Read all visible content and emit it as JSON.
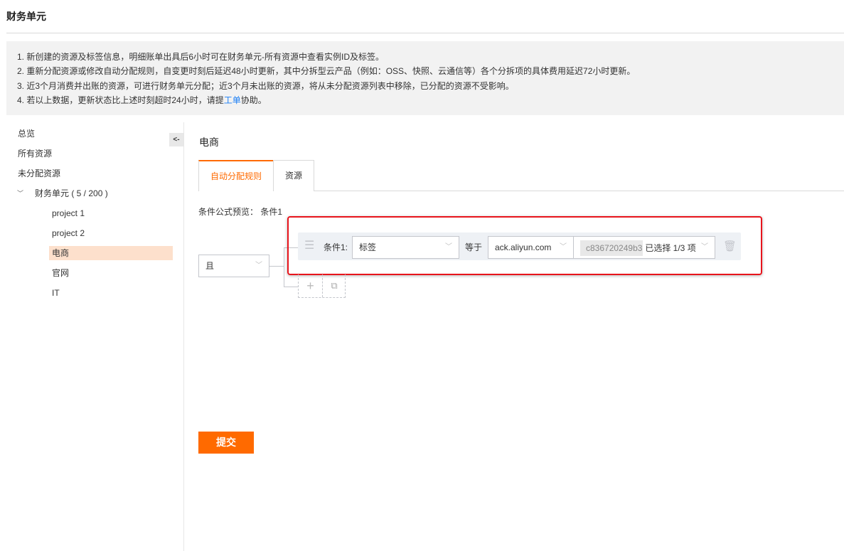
{
  "page_title": "财务单元",
  "notice": {
    "line1": "1. 新创建的资源及标签信息，明细账单出具后6小时可在财务单元-所有资源中查看实例ID及标签。",
    "line2": "2. 重新分配资源或修改自动分配规则，自变更时刻后延迟48小时更新，其中分拆型云产品（例如：OSS、快照、云通信等）各个分拆项的具体费用延迟72小时更新。",
    "line3": "3. 近3个月消费并出账的资源，可进行财务单元分配；近3个月未出账的资源，将从未分配资源列表中移除，已分配的资源不受影响。",
    "line4_prefix": "4. 若以上数据，更新状态比上述时刻超时24小时，请提",
    "line4_link": "工单",
    "line4_suffix": "协助。"
  },
  "sidebar": {
    "collapse_label": "<-",
    "items": [
      "总览",
      "所有资源",
      "未分配资源"
    ],
    "group_label": "财务单元 ( 5 / 200 )",
    "children": [
      "project 1",
      "project 2",
      "电商",
      "官网",
      "IT"
    ]
  },
  "main": {
    "heading": "电商",
    "tabs": [
      "自动分配规则",
      "资源"
    ],
    "preview_label": "条件公式预览：",
    "preview_value": "条件1",
    "logic_select": "且",
    "condition": {
      "label": "条件1:",
      "field": "标签",
      "operator": "等于",
      "key": "ack.aliyun.com",
      "value_tag": "c836720249b3",
      "value_summary": "已选择 1/3 项"
    },
    "submit_label": "提交"
  },
  "colors": {
    "accent": "#ff6a00",
    "highlight": "#fde0cc",
    "alert": "#e8141c"
  }
}
